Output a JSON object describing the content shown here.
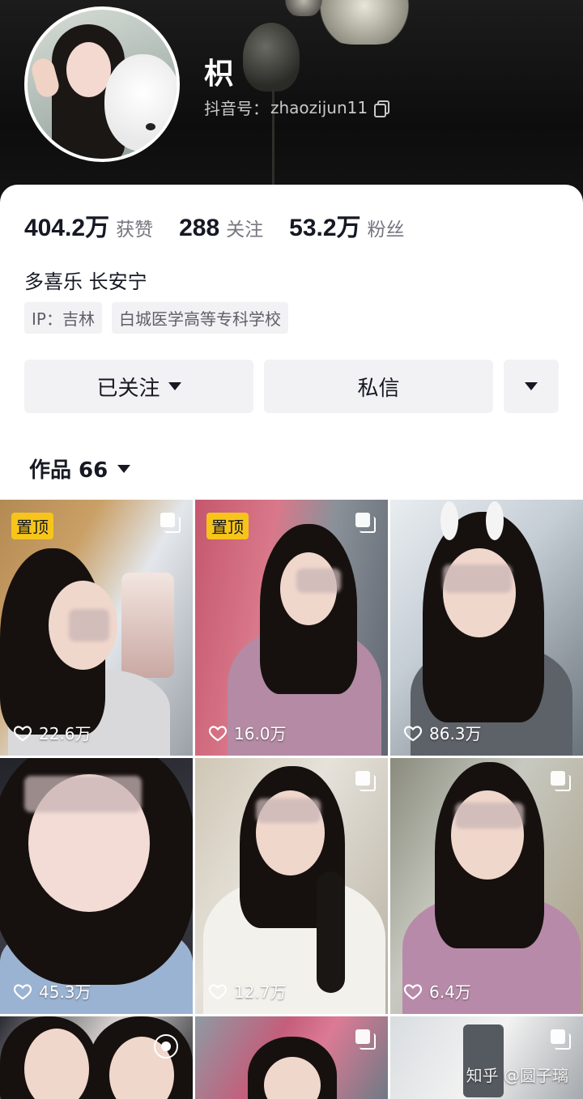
{
  "profile": {
    "username": "枳",
    "handle_label": "抖音号：",
    "handle_value": "zhaozijun11",
    "bio": "多喜乐 长安宁",
    "tags": [
      "IP：吉林",
      "白城医学高等专科学校"
    ]
  },
  "stats": [
    {
      "value": "404.2万",
      "label": "获赞"
    },
    {
      "value": "288",
      "label": "关注"
    },
    {
      "value": "53.2万",
      "label": "粉丝"
    }
  ],
  "actions": {
    "follow_label": "已关注",
    "message_label": "私信"
  },
  "works": {
    "label": "作品 66"
  },
  "pinned_label": "置顶",
  "videos": [
    {
      "likes": "22.6万",
      "pinned": true,
      "icon": "multi-image-icon"
    },
    {
      "likes": "16.0万",
      "pinned": true,
      "icon": "multi-image-icon"
    },
    {
      "likes": "86.3万",
      "pinned": false,
      "icon": "none"
    },
    {
      "likes": "45.3万",
      "pinned": false,
      "icon": "none"
    },
    {
      "likes": "12.7万",
      "pinned": false,
      "icon": "multi-image-icon"
    },
    {
      "likes": "6.4万",
      "pinned": false,
      "icon": "multi-image-icon"
    },
    {
      "likes": "",
      "pinned": false,
      "icon": "live-photo-icon"
    },
    {
      "likes": "",
      "pinned": false,
      "icon": "multi-image-icon"
    },
    {
      "likes": "",
      "pinned": false,
      "icon": "multi-image-icon"
    }
  ],
  "watermark": "知乎 @圆子璃",
  "colors": {
    "pin_badge": "#f7c51a",
    "button_bg": "#f2f2f4",
    "header_bg": "#111111"
  }
}
